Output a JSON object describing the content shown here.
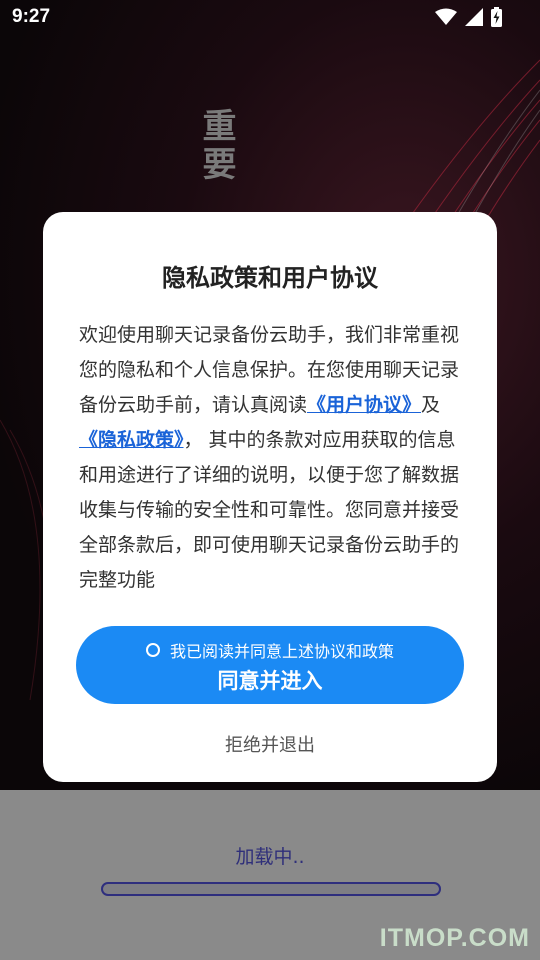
{
  "status_bar": {
    "time": "9:27",
    "icons": [
      "wifi-icon",
      "cellular-signal-icon",
      "battery-charging-icon"
    ]
  },
  "background": {
    "heading": "重要"
  },
  "dialog": {
    "title": "隐私政策和用户协议",
    "body": {
      "text_before": "欢迎使用聊天记录备份云助手，我们非常重视您的隐私和个人信息保护。在您使用聊天记录备份云助手前，请认真阅读",
      "user_agreement_link": "《用户协议》",
      "and_text": "及",
      "privacy_policy_link": "《隐私政策》",
      "text_after": "， 其中的条款对应用获取的信息和用途进行了详细的说明，以便于您了解数据收集与传输的安全性和可靠性。您同意并接受全部条款后，即可使用聊天记录备份云助手的完整功能"
    },
    "consent_label": "我已阅读并同意上述协议和政策",
    "consent_checked": false,
    "agree_button": "同意并进入",
    "reject_button": "拒绝并退出"
  },
  "loading": {
    "text": "加载中..",
    "progress": 0
  },
  "watermark": "ITMOP.COM",
  "colors": {
    "accent": "#1b8af4",
    "link": "#1a63d8",
    "panel_bg": "#8a8a8a",
    "progress_border": "#2e2e7e"
  }
}
